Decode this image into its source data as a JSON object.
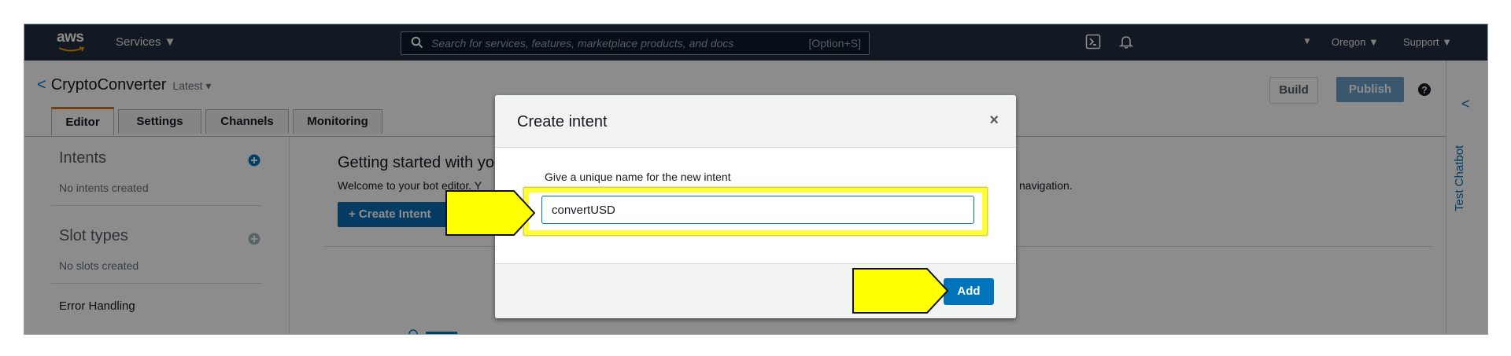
{
  "topnav": {
    "logo_text": "aws",
    "services_label": "Services ▼",
    "search_placeholder": "Search for services, features, marketplace products, and docs",
    "search_shortcut": "[Option+S]",
    "account_caret": "▼",
    "region_label": "Oregon ▼",
    "support_label": "Support ▼"
  },
  "bot": {
    "back_glyph": "<",
    "name": "CryptoConverter",
    "version": "Latest ▾",
    "build_label": "Build",
    "publish_label": "Publish",
    "help_glyph": "?"
  },
  "tabs": [
    {
      "label": "Editor",
      "active": true
    },
    {
      "label": "Settings",
      "active": false
    },
    {
      "label": "Channels",
      "active": false
    },
    {
      "label": "Monitoring",
      "active": false
    }
  ],
  "leftnav": {
    "intents_heading": "Intents",
    "intents_empty": "No intents created",
    "slot_types_heading": "Slot types",
    "slots_empty": "No slots created",
    "error_handling": "Error Handling"
  },
  "main": {
    "title": "Getting started with yo",
    "welcome_text": "Welcome to your bot editor. Y",
    "welcome_tail": "navigation.",
    "create_intent_label": "+  Create Intent"
  },
  "side_panel": {
    "collapse_glyph": "<",
    "label": "Test Chatbot"
  },
  "modal": {
    "title": "Create intent",
    "close_glyph": "×",
    "field_label": "Give a unique name for the new intent",
    "input_value": "convertUSD",
    "add_label": "Add"
  },
  "colors": {
    "nav_bg": "#232f3e",
    "accent_blue": "#0073bb",
    "tab_accent": "#ec7211",
    "callout_yellow": "#ffff33"
  }
}
